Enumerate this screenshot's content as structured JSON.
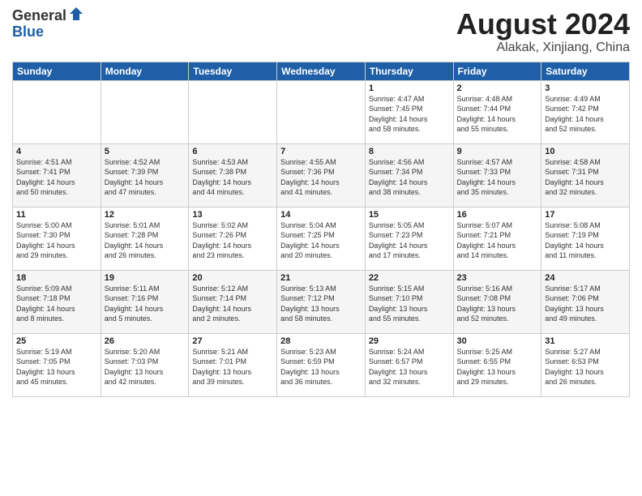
{
  "logo": {
    "general": "General",
    "blue": "Blue"
  },
  "title": "August 2024",
  "location": "Alakak, Xinjiang, China",
  "weekdays": [
    "Sunday",
    "Monday",
    "Tuesday",
    "Wednesday",
    "Thursday",
    "Friday",
    "Saturday"
  ],
  "weeks": [
    [
      {
        "day": "",
        "info": ""
      },
      {
        "day": "",
        "info": ""
      },
      {
        "day": "",
        "info": ""
      },
      {
        "day": "",
        "info": ""
      },
      {
        "day": "1",
        "info": "Sunrise: 4:47 AM\nSunset: 7:45 PM\nDaylight: 14 hours\nand 58 minutes."
      },
      {
        "day": "2",
        "info": "Sunrise: 4:48 AM\nSunset: 7:44 PM\nDaylight: 14 hours\nand 55 minutes."
      },
      {
        "day": "3",
        "info": "Sunrise: 4:49 AM\nSunset: 7:42 PM\nDaylight: 14 hours\nand 52 minutes."
      }
    ],
    [
      {
        "day": "4",
        "info": "Sunrise: 4:51 AM\nSunset: 7:41 PM\nDaylight: 14 hours\nand 50 minutes."
      },
      {
        "day": "5",
        "info": "Sunrise: 4:52 AM\nSunset: 7:39 PM\nDaylight: 14 hours\nand 47 minutes."
      },
      {
        "day": "6",
        "info": "Sunrise: 4:53 AM\nSunset: 7:38 PM\nDaylight: 14 hours\nand 44 minutes."
      },
      {
        "day": "7",
        "info": "Sunrise: 4:55 AM\nSunset: 7:36 PM\nDaylight: 14 hours\nand 41 minutes."
      },
      {
        "day": "8",
        "info": "Sunrise: 4:56 AM\nSunset: 7:34 PM\nDaylight: 14 hours\nand 38 minutes."
      },
      {
        "day": "9",
        "info": "Sunrise: 4:57 AM\nSunset: 7:33 PM\nDaylight: 14 hours\nand 35 minutes."
      },
      {
        "day": "10",
        "info": "Sunrise: 4:58 AM\nSunset: 7:31 PM\nDaylight: 14 hours\nand 32 minutes."
      }
    ],
    [
      {
        "day": "11",
        "info": "Sunrise: 5:00 AM\nSunset: 7:30 PM\nDaylight: 14 hours\nand 29 minutes."
      },
      {
        "day": "12",
        "info": "Sunrise: 5:01 AM\nSunset: 7:28 PM\nDaylight: 14 hours\nand 26 minutes."
      },
      {
        "day": "13",
        "info": "Sunrise: 5:02 AM\nSunset: 7:26 PM\nDaylight: 14 hours\nand 23 minutes."
      },
      {
        "day": "14",
        "info": "Sunrise: 5:04 AM\nSunset: 7:25 PM\nDaylight: 14 hours\nand 20 minutes."
      },
      {
        "day": "15",
        "info": "Sunrise: 5:05 AM\nSunset: 7:23 PM\nDaylight: 14 hours\nand 17 minutes."
      },
      {
        "day": "16",
        "info": "Sunrise: 5:07 AM\nSunset: 7:21 PM\nDaylight: 14 hours\nand 14 minutes."
      },
      {
        "day": "17",
        "info": "Sunrise: 5:08 AM\nSunset: 7:19 PM\nDaylight: 14 hours\nand 11 minutes."
      }
    ],
    [
      {
        "day": "18",
        "info": "Sunrise: 5:09 AM\nSunset: 7:18 PM\nDaylight: 14 hours\nand 8 minutes."
      },
      {
        "day": "19",
        "info": "Sunrise: 5:11 AM\nSunset: 7:16 PM\nDaylight: 14 hours\nand 5 minutes."
      },
      {
        "day": "20",
        "info": "Sunrise: 5:12 AM\nSunset: 7:14 PM\nDaylight: 14 hours\nand 2 minutes."
      },
      {
        "day": "21",
        "info": "Sunrise: 5:13 AM\nSunset: 7:12 PM\nDaylight: 13 hours\nand 58 minutes."
      },
      {
        "day": "22",
        "info": "Sunrise: 5:15 AM\nSunset: 7:10 PM\nDaylight: 13 hours\nand 55 minutes."
      },
      {
        "day": "23",
        "info": "Sunrise: 5:16 AM\nSunset: 7:08 PM\nDaylight: 13 hours\nand 52 minutes."
      },
      {
        "day": "24",
        "info": "Sunrise: 5:17 AM\nSunset: 7:06 PM\nDaylight: 13 hours\nand 49 minutes."
      }
    ],
    [
      {
        "day": "25",
        "info": "Sunrise: 5:19 AM\nSunset: 7:05 PM\nDaylight: 13 hours\nand 45 minutes."
      },
      {
        "day": "26",
        "info": "Sunrise: 5:20 AM\nSunset: 7:03 PM\nDaylight: 13 hours\nand 42 minutes."
      },
      {
        "day": "27",
        "info": "Sunrise: 5:21 AM\nSunset: 7:01 PM\nDaylight: 13 hours\nand 39 minutes."
      },
      {
        "day": "28",
        "info": "Sunrise: 5:23 AM\nSunset: 6:59 PM\nDaylight: 13 hours\nand 36 minutes."
      },
      {
        "day": "29",
        "info": "Sunrise: 5:24 AM\nSunset: 6:57 PM\nDaylight: 13 hours\nand 32 minutes."
      },
      {
        "day": "30",
        "info": "Sunrise: 5:25 AM\nSunset: 6:55 PM\nDaylight: 13 hours\nand 29 minutes."
      },
      {
        "day": "31",
        "info": "Sunrise: 5:27 AM\nSunset: 6:53 PM\nDaylight: 13 hours\nand 26 minutes."
      }
    ]
  ]
}
